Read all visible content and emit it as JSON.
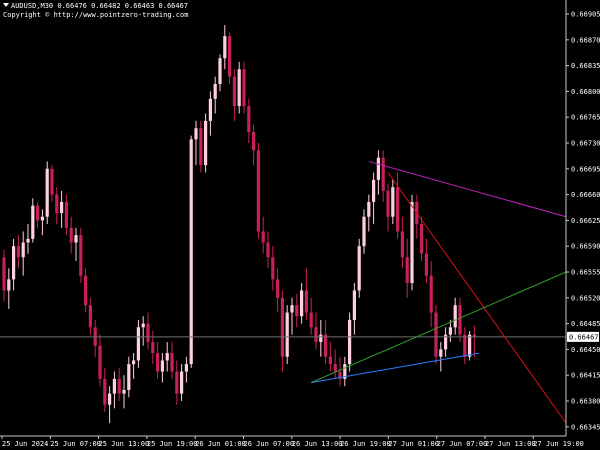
{
  "header": {
    "symbol": "AUDUSD,M30",
    "ohlc": "0.66476 0.66482 0.66463 0.66467",
    "copyright": "Copyright © http://www.pointzero-trading.com"
  },
  "colors": {
    "background": "#000000",
    "axis": "#c8c8c8",
    "text": "#ffffff",
    "candle_bull": "#ffd0e0",
    "candle_bear": "#c8205c",
    "price_line": "#707070",
    "label_bg": "#ffffff",
    "label_text": "#000000"
  },
  "chart_data": {
    "type": "candlestick",
    "yaxis": {
      "ticks": [
        "0.66905",
        "0.66870",
        "0.66835",
        "0.66800",
        "0.66765",
        "0.66730",
        "0.66695",
        "0.66660",
        "0.66625",
        "0.66590",
        "0.66555",
        "0.66520",
        "0.66485",
        "0.66450",
        "0.66415",
        "0.66380",
        "0.66345"
      ]
    },
    "xaxis": {
      "ticks": [
        "25 Jun 2024",
        "25 Jun 07:00",
        "25 Jun 13:00",
        "25 Jun 19:00",
        "26 Jun 01:00",
        "26 Jun 07:00",
        "26 Jun 13:00",
        "26 Jun 19:00",
        "27 Jun 01:00",
        "27 Jun 07:00",
        "27 Jun 13:00",
        "27 Jun 19:00"
      ]
    },
    "current_price": "0.66467",
    "candles": [
      {
        "o": 0.66575,
        "h": 0.66585,
        "l": 0.66515,
        "c": 0.6653
      },
      {
        "o": 0.6653,
        "h": 0.6656,
        "l": 0.66505,
        "c": 0.66545
      },
      {
        "o": 0.66545,
        "h": 0.666,
        "l": 0.6653,
        "c": 0.6659
      },
      {
        "o": 0.6659,
        "h": 0.66605,
        "l": 0.6656,
        "c": 0.66575
      },
      {
        "o": 0.66575,
        "h": 0.6661,
        "l": 0.6655,
        "c": 0.66595
      },
      {
        "o": 0.66595,
        "h": 0.6662,
        "l": 0.6658,
        "c": 0.666
      },
      {
        "o": 0.666,
        "h": 0.66655,
        "l": 0.66595,
        "c": 0.66645
      },
      {
        "o": 0.66645,
        "h": 0.6665,
        "l": 0.66615,
        "c": 0.66625
      },
      {
        "o": 0.66625,
        "h": 0.6664,
        "l": 0.66605,
        "c": 0.6663
      },
      {
        "o": 0.6663,
        "h": 0.66705,
        "l": 0.6662,
        "c": 0.66695
      },
      {
        "o": 0.66695,
        "h": 0.667,
        "l": 0.6665,
        "c": 0.6666
      },
      {
        "o": 0.6666,
        "h": 0.6667,
        "l": 0.6662,
        "c": 0.66635
      },
      {
        "o": 0.66635,
        "h": 0.66665,
        "l": 0.66615,
        "c": 0.6665
      },
      {
        "o": 0.6665,
        "h": 0.6666,
        "l": 0.66605,
        "c": 0.66615
      },
      {
        "o": 0.66615,
        "h": 0.6663,
        "l": 0.6658,
        "c": 0.66595
      },
      {
        "o": 0.66595,
        "h": 0.66615,
        "l": 0.6657,
        "c": 0.66605
      },
      {
        "o": 0.66605,
        "h": 0.66615,
        "l": 0.6654,
        "c": 0.6655
      },
      {
        "o": 0.6655,
        "h": 0.6656,
        "l": 0.665,
        "c": 0.6651
      },
      {
        "o": 0.6651,
        "h": 0.6652,
        "l": 0.6647,
        "c": 0.6648
      },
      {
        "o": 0.6648,
        "h": 0.6649,
        "l": 0.6644,
        "c": 0.66455
      },
      {
        "o": 0.66455,
        "h": 0.6647,
        "l": 0.664,
        "c": 0.6641
      },
      {
        "o": 0.6641,
        "h": 0.66425,
        "l": 0.66365,
        "c": 0.66375
      },
      {
        "o": 0.66375,
        "h": 0.664,
        "l": 0.6635,
        "c": 0.6639
      },
      {
        "o": 0.6639,
        "h": 0.6642,
        "l": 0.6637,
        "c": 0.6641
      },
      {
        "o": 0.6641,
        "h": 0.66425,
        "l": 0.6638,
        "c": 0.6639
      },
      {
        "o": 0.6639,
        "h": 0.66415,
        "l": 0.6637,
        "c": 0.66395
      },
      {
        "o": 0.66395,
        "h": 0.6644,
        "l": 0.66385,
        "c": 0.6643
      },
      {
        "o": 0.6643,
        "h": 0.66445,
        "l": 0.6641,
        "c": 0.66435
      },
      {
        "o": 0.66435,
        "h": 0.6649,
        "l": 0.66425,
        "c": 0.6648
      },
      {
        "o": 0.6648,
        "h": 0.66495,
        "l": 0.66455,
        "c": 0.66485
      },
      {
        "o": 0.66485,
        "h": 0.665,
        "l": 0.6645,
        "c": 0.6646
      },
      {
        "o": 0.6646,
        "h": 0.66475,
        "l": 0.6643,
        "c": 0.66445
      },
      {
        "o": 0.66445,
        "h": 0.6646,
        "l": 0.6641,
        "c": 0.6642
      },
      {
        "o": 0.6642,
        "h": 0.66445,
        "l": 0.66405,
        "c": 0.66435
      },
      {
        "o": 0.66435,
        "h": 0.6646,
        "l": 0.6642,
        "c": 0.66445
      },
      {
        "o": 0.66445,
        "h": 0.6646,
        "l": 0.6641,
        "c": 0.6642
      },
      {
        "o": 0.6642,
        "h": 0.66435,
        "l": 0.66375,
        "c": 0.6639
      },
      {
        "o": 0.6639,
        "h": 0.6643,
        "l": 0.6638,
        "c": 0.6642
      },
      {
        "o": 0.6642,
        "h": 0.6644,
        "l": 0.66405,
        "c": 0.6643
      },
      {
        "o": 0.6643,
        "h": 0.6674,
        "l": 0.66425,
        "c": 0.66735
      },
      {
        "o": 0.66735,
        "h": 0.6676,
        "l": 0.667,
        "c": 0.6675
      },
      {
        "o": 0.6675,
        "h": 0.6676,
        "l": 0.6669,
        "c": 0.667
      },
      {
        "o": 0.667,
        "h": 0.6677,
        "l": 0.6669,
        "c": 0.6676
      },
      {
        "o": 0.6676,
        "h": 0.668,
        "l": 0.6674,
        "c": 0.6679
      },
      {
        "o": 0.6679,
        "h": 0.6682,
        "l": 0.6677,
        "c": 0.6681
      },
      {
        "o": 0.6681,
        "h": 0.6685,
        "l": 0.668,
        "c": 0.66845
      },
      {
        "o": 0.66845,
        "h": 0.6689,
        "l": 0.6683,
        "c": 0.66875
      },
      {
        "o": 0.66875,
        "h": 0.6688,
        "l": 0.6681,
        "c": 0.6682
      },
      {
        "o": 0.6682,
        "h": 0.6683,
        "l": 0.6676,
        "c": 0.6678
      },
      {
        "o": 0.6678,
        "h": 0.6684,
        "l": 0.6677,
        "c": 0.6683
      },
      {
        "o": 0.6683,
        "h": 0.6684,
        "l": 0.6677,
        "c": 0.6678
      },
      {
        "o": 0.6678,
        "h": 0.6679,
        "l": 0.6673,
        "c": 0.66745
      },
      {
        "o": 0.66745,
        "h": 0.66755,
        "l": 0.667,
        "c": 0.6672
      },
      {
        "o": 0.6672,
        "h": 0.6673,
        "l": 0.666,
        "c": 0.6661
      },
      {
        "o": 0.6661,
        "h": 0.6663,
        "l": 0.6658,
        "c": 0.66595
      },
      {
        "o": 0.66595,
        "h": 0.6661,
        "l": 0.6656,
        "c": 0.66575
      },
      {
        "o": 0.66575,
        "h": 0.6659,
        "l": 0.6653,
        "c": 0.66545
      },
      {
        "o": 0.66545,
        "h": 0.6656,
        "l": 0.665,
        "c": 0.6652
      },
      {
        "o": 0.6652,
        "h": 0.6653,
        "l": 0.6642,
        "c": 0.6644
      },
      {
        "o": 0.6644,
        "h": 0.6651,
        "l": 0.6643,
        "c": 0.665
      },
      {
        "o": 0.665,
        "h": 0.6652,
        "l": 0.6647,
        "c": 0.6651
      },
      {
        "o": 0.6651,
        "h": 0.66525,
        "l": 0.6648,
        "c": 0.66495
      },
      {
        "o": 0.66495,
        "h": 0.6654,
        "l": 0.66485,
        "c": 0.6653
      },
      {
        "o": 0.6653,
        "h": 0.6656,
        "l": 0.6649,
        "c": 0.665
      },
      {
        "o": 0.665,
        "h": 0.6652,
        "l": 0.6647,
        "c": 0.6648
      },
      {
        "o": 0.6648,
        "h": 0.665,
        "l": 0.6645,
        "c": 0.6646
      },
      {
        "o": 0.6646,
        "h": 0.6649,
        "l": 0.6644,
        "c": 0.6647
      },
      {
        "o": 0.6647,
        "h": 0.6649,
        "l": 0.6643,
        "c": 0.6644
      },
      {
        "o": 0.6644,
        "h": 0.6646,
        "l": 0.6642,
        "c": 0.6643
      },
      {
        "o": 0.6643,
        "h": 0.6645,
        "l": 0.6641,
        "c": 0.6642
      },
      {
        "o": 0.6642,
        "h": 0.6644,
        "l": 0.664,
        "c": 0.6641
      },
      {
        "o": 0.6641,
        "h": 0.6644,
        "l": 0.664,
        "c": 0.6643
      },
      {
        "o": 0.6643,
        "h": 0.665,
        "l": 0.6642,
        "c": 0.6649
      },
      {
        "o": 0.6649,
        "h": 0.6654,
        "l": 0.6647,
        "c": 0.6653
      },
      {
        "o": 0.6653,
        "h": 0.666,
        "l": 0.6652,
        "c": 0.6659
      },
      {
        "o": 0.6659,
        "h": 0.6664,
        "l": 0.6658,
        "c": 0.6663
      },
      {
        "o": 0.6663,
        "h": 0.6666,
        "l": 0.6661,
        "c": 0.6665
      },
      {
        "o": 0.6665,
        "h": 0.6669,
        "l": 0.6662,
        "c": 0.6668
      },
      {
        "o": 0.6668,
        "h": 0.6672,
        "l": 0.6666,
        "c": 0.6671
      },
      {
        "o": 0.6671,
        "h": 0.6672,
        "l": 0.6665,
        "c": 0.66665
      },
      {
        "o": 0.66665,
        "h": 0.66675,
        "l": 0.6661,
        "c": 0.6663
      },
      {
        "o": 0.6663,
        "h": 0.6668,
        "l": 0.6662,
        "c": 0.6667
      },
      {
        "o": 0.6667,
        "h": 0.6669,
        "l": 0.666,
        "c": 0.6661
      },
      {
        "o": 0.6661,
        "h": 0.6663,
        "l": 0.6656,
        "c": 0.66575
      },
      {
        "o": 0.66575,
        "h": 0.666,
        "l": 0.6652,
        "c": 0.6654
      },
      {
        "o": 0.6654,
        "h": 0.6666,
        "l": 0.6653,
        "c": 0.6665
      },
      {
        "o": 0.6665,
        "h": 0.6666,
        "l": 0.666,
        "c": 0.6662
      },
      {
        "o": 0.6662,
        "h": 0.6663,
        "l": 0.6657,
        "c": 0.6658
      },
      {
        "o": 0.6658,
        "h": 0.666,
        "l": 0.6654,
        "c": 0.6655
      },
      {
        "o": 0.6655,
        "h": 0.6657,
        "l": 0.6648,
        "c": 0.665
      },
      {
        "o": 0.665,
        "h": 0.6651,
        "l": 0.6643,
        "c": 0.6644
      },
      {
        "o": 0.6644,
        "h": 0.6646,
        "l": 0.6642,
        "c": 0.6645
      },
      {
        "o": 0.6645,
        "h": 0.6648,
        "l": 0.6644,
        "c": 0.6647
      },
      {
        "o": 0.6647,
        "h": 0.6649,
        "l": 0.6646,
        "c": 0.6648
      },
      {
        "o": 0.6648,
        "h": 0.6652,
        "l": 0.6647,
        "c": 0.6651
      },
      {
        "o": 0.6651,
        "h": 0.6652,
        "l": 0.6646,
        "c": 0.6647
      },
      {
        "o": 0.6647,
        "h": 0.6648,
        "l": 0.6643,
        "c": 0.6644
      },
      {
        "o": 0.6644,
        "h": 0.66475,
        "l": 0.66435,
        "c": 0.6647
      },
      {
        "o": 0.6647,
        "h": 0.66482,
        "l": 0.6644,
        "c": 0.66467
      }
    ],
    "trendlines": [
      {
        "color": "#c020c0",
        "from": {
          "i": 76,
          "p": 0.66705
        },
        "to": {
          "i": 999,
          "p": 0.6663
        }
      },
      {
        "color": "#e01010",
        "from": {
          "i": 80,
          "p": 0.6669
        },
        "to": {
          "i": 999,
          "p": 0.6635
        }
      },
      {
        "color": "#2a7fff",
        "from": {
          "i": 64,
          "p": 0.66405
        },
        "to": {
          "i": 99,
          "p": 0.66445
        }
      },
      {
        "color": "#2fa02f",
        "from": {
          "i": 64,
          "p": 0.66405
        },
        "to": {
          "i": 999,
          "p": 0.66555
        }
      }
    ]
  }
}
